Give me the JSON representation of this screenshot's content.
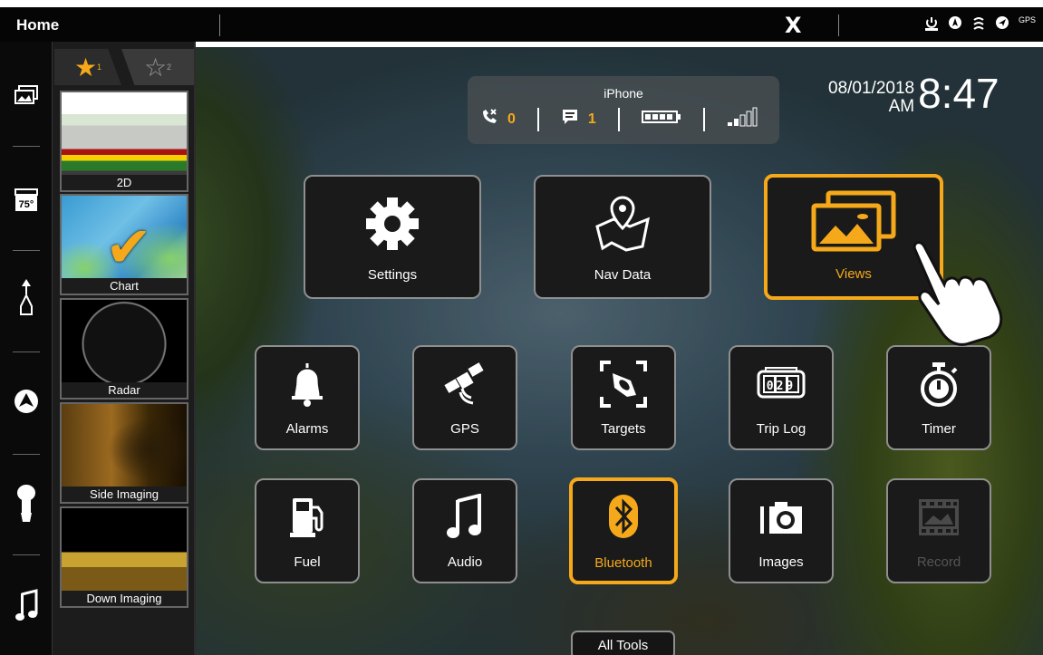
{
  "topbar": {
    "title": "Home",
    "brand_mark": "X",
    "status_icons": [
      "power-icon",
      "compass-icon",
      "depth-icon",
      "navigation-icon",
      "gps-icon"
    ],
    "gps_label": "GPS"
  },
  "rail": {
    "items": [
      {
        "name": "views-icon"
      },
      {
        "name": "temperature-icon",
        "text": "75°"
      },
      {
        "name": "boat-heading-icon"
      },
      {
        "name": "autopilot-icon"
      },
      {
        "name": "trolling-motor-icon"
      },
      {
        "name": "music-icon"
      }
    ]
  },
  "favorites": {
    "tabs": [
      {
        "label": "1",
        "active": true
      },
      {
        "label": "2",
        "active": false
      }
    ],
    "items": [
      {
        "label": "2D"
      },
      {
        "label": "Chart"
      },
      {
        "label": "Radar"
      },
      {
        "label": "Side Imaging"
      },
      {
        "label": "Down Imaging"
      }
    ]
  },
  "phone": {
    "name": "iPhone",
    "missed_calls": "0",
    "messages": "1"
  },
  "datetime": {
    "date": "08/01/2018",
    "ampm": "AM",
    "time": "8:47"
  },
  "tiles": {
    "settings": "Settings",
    "nav_data": "Nav Data",
    "views": "Views",
    "alarms": "Alarms",
    "gps": "GPS",
    "targets": "Targets",
    "trip_log": "Trip Log",
    "trip_log_digits": "029",
    "timer": "Timer",
    "fuel": "Fuel",
    "audio": "Audio",
    "bluetooth": "Bluetooth",
    "images": "Images",
    "record": "Record"
  },
  "all_tools": "All Tools",
  "colors": {
    "accent": "#f5a91a",
    "tile_bg": "#1a1a1a",
    "tile_border": "#8f8f8f"
  }
}
